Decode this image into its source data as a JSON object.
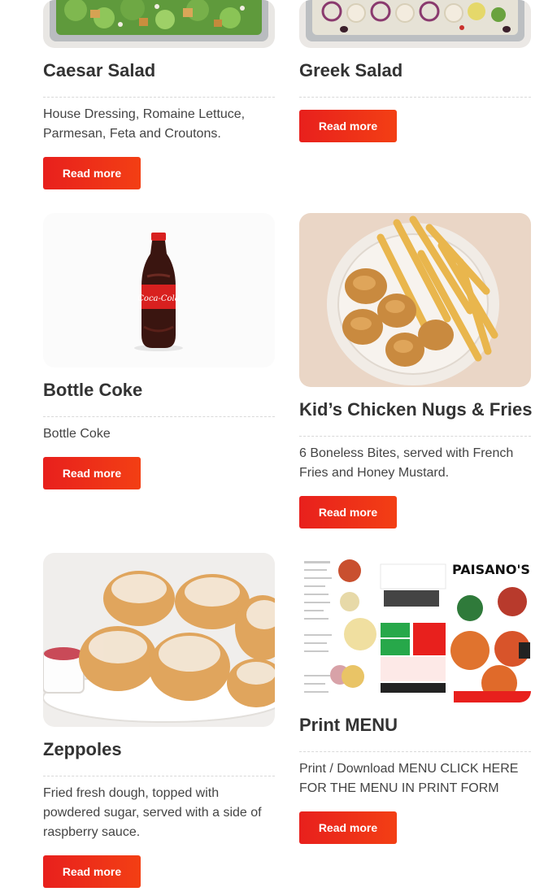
{
  "items": [
    {
      "title": "Caesar Salad",
      "description": "House Dressing, Romaine Lettuce, Parmesan, Feta and Croutons.",
      "button": "Read more",
      "image_icon": "salad-tray-image"
    },
    {
      "title": "Greek Salad",
      "description": "",
      "button": "Read more",
      "image_icon": "greek-salad-tray-image"
    },
    {
      "title": "Bottle Coke",
      "description": "Bottle Coke",
      "button": "Read more",
      "image_icon": "coke-bottle-image",
      "bottle_label": "Coca-Cola"
    },
    {
      "title": "Kid’s Chicken Nugs & Fries",
      "description": "6 Boneless Bites, served with French Fries and Honey Mustard.",
      "button": "Read more",
      "image_icon": "chicken-fries-plate-image"
    },
    {
      "title": "Zeppoles",
      "description": "Fried fresh dough, topped with powdered sugar, served with a side of raspberry sauce.",
      "button": "Read more",
      "image_icon": "zeppoles-plate-image"
    },
    {
      "title": "Print MENU",
      "description": "Print / Download MENU CLICK HERE FOR THE MENU IN PRINT FORM",
      "button": "Read more",
      "image_icon": "printed-menu-flyer-image",
      "menu_logo": "PAISANO'S"
    }
  ],
  "colors": {
    "button_start": "#e8201d",
    "button_end": "#f33f14",
    "title": "#333333"
  }
}
